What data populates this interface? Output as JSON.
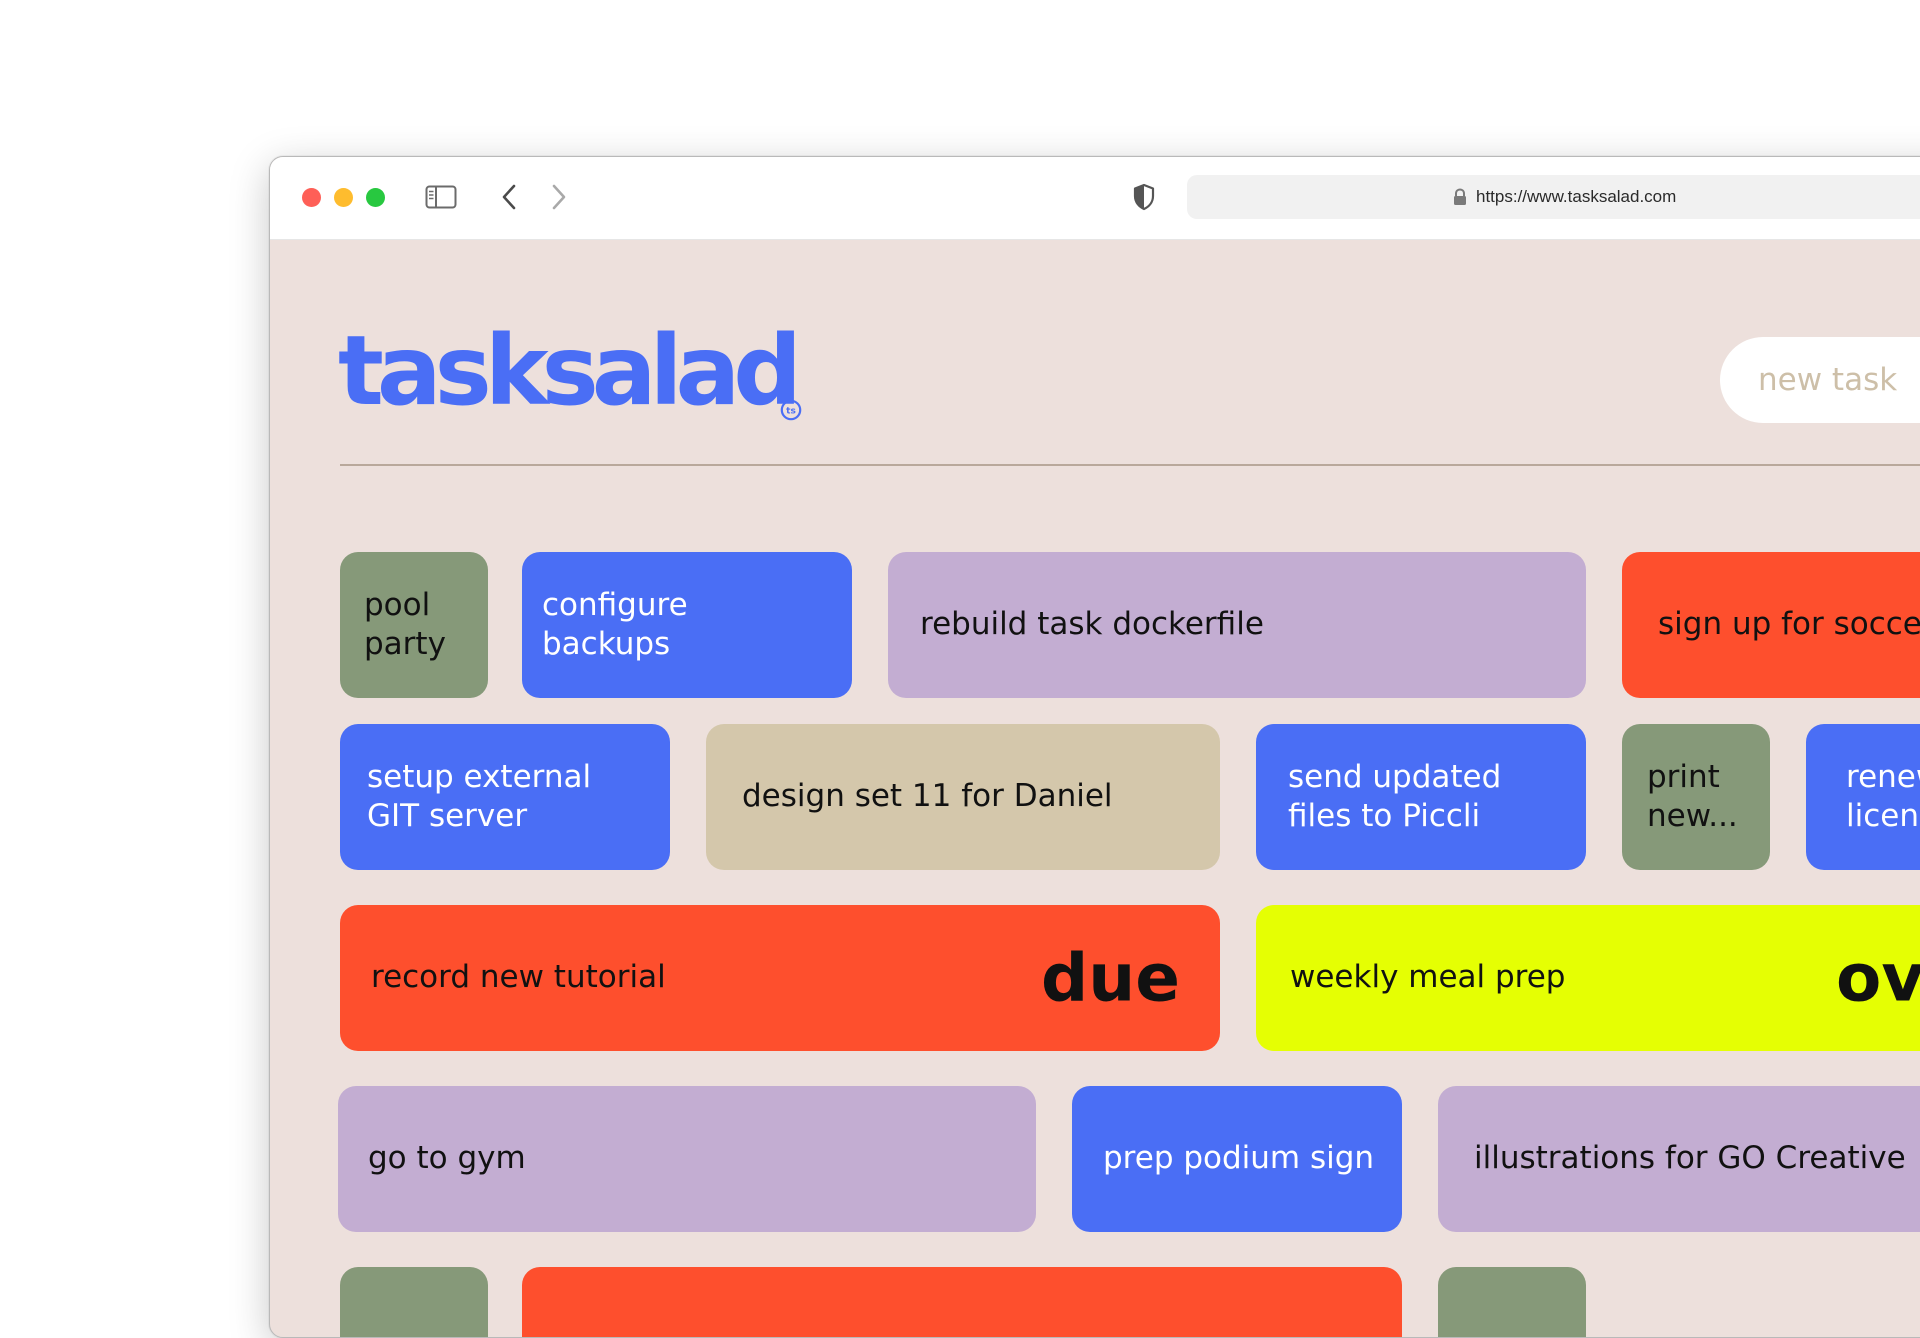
{
  "browser": {
    "url": "https://www.tasksalad.com",
    "icons": [
      "sidebar-toggle-icon",
      "back-arrow-icon",
      "forward-arrow-icon",
      "shield-icon",
      "lock-icon"
    ]
  },
  "app": {
    "logo": "tasksalad",
    "logo_mark": "ts",
    "new_task_placeholder": "new task"
  },
  "colors": {
    "page_bg": "#ede0dc",
    "green": "#869979",
    "blue": "#4a6ef5",
    "lavender": "#c3add2",
    "orange": "#fe4f2d",
    "beige": "#d4c7ab",
    "lime": "#e5ff03"
  },
  "tasks": [
    {
      "label": "pool\nparty",
      "color": "green",
      "text_color": "#111111"
    },
    {
      "label": "configure\nbackups",
      "color": "blue",
      "text_color": "#ffffff"
    },
    {
      "label": "rebuild task dockerfile",
      "color": "lavender",
      "text_color": "#111111"
    },
    {
      "label": "sign up for socce",
      "color": "orange",
      "text_color": "#111111"
    },
    {
      "label": "setup external\nGIT server",
      "color": "blue",
      "text_color": "#ffffff"
    },
    {
      "label": "design set 11 for Daniel",
      "color": "beige",
      "text_color": "#111111"
    },
    {
      "label": "send updated\nfiles to Piccli",
      "color": "blue",
      "text_color": "#ffffff"
    },
    {
      "label": "print\nnew...",
      "color": "green",
      "text_color": "#111111"
    },
    {
      "label": "renew\nlicens",
      "color": "blue",
      "text_color": "#ffffff"
    },
    {
      "label": "record new tutorial",
      "badge": "due",
      "color": "orange",
      "text_color": "#111111"
    },
    {
      "label": "weekly meal prep",
      "badge": "ove",
      "color": "lime",
      "text_color": "#111111"
    },
    {
      "label": "go to gym",
      "color": "lavender",
      "text_color": "#111111"
    },
    {
      "label": "prep podium sign",
      "color": "blue",
      "text_color": "#ffffff"
    },
    {
      "label": "illustrations for GO Creative",
      "color": "lavender",
      "text_color": "#111111"
    },
    {
      "label": "",
      "color": "green",
      "text_color": "#111111"
    },
    {
      "label": "",
      "color": "orange",
      "text_color": "#111111"
    },
    {
      "label": "",
      "color": "green",
      "text_color": "#111111"
    }
  ]
}
